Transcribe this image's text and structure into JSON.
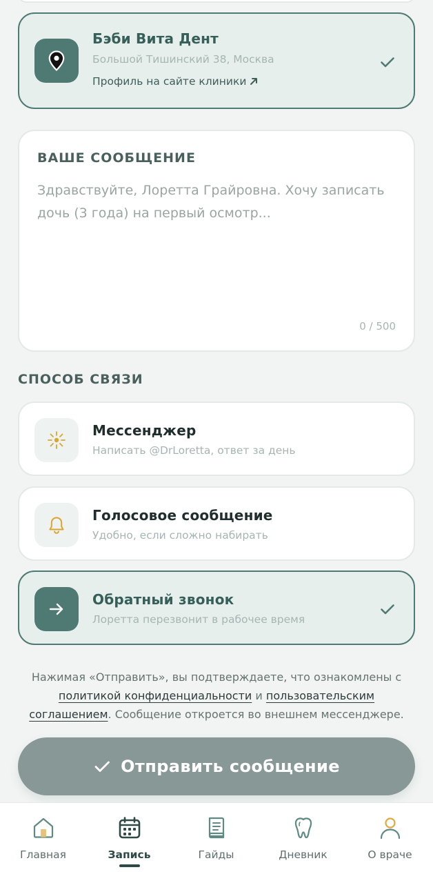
{
  "clinic": {
    "name": "Бэби Вита Дент",
    "address": "Большой Тишинский 38, Москва",
    "profile_link": "Профиль на сайте клиники",
    "selected": true
  },
  "message": {
    "label": "ВАШЕ СООБЩЕНИЕ",
    "placeholder": "Здравствуйте, Лоретта Грайровна. Хочу записать дочь (3 года) на первый осмотр...",
    "counter": "0 / 500"
  },
  "contact": {
    "label": "СПОСОБ СВЯЗИ",
    "options": [
      {
        "title": "Мессенджер",
        "subtitle": "Написать @DrLoretta, ответ за день",
        "icon": "sun-icon",
        "selected": false
      },
      {
        "title": "Голосовое сообщение",
        "subtitle": "Удобно, если сложно набирать",
        "icon": "bell-icon",
        "selected": false
      },
      {
        "title": "Обратный звонок",
        "subtitle": "Лоретта перезвонит в рабочее время",
        "icon": "arrow-right-icon",
        "selected": true
      }
    ]
  },
  "consent": {
    "prefix": "Нажимая «Отправить», вы подтверждаете, что ознакомлены с ",
    "privacy_link": "политикой конфиденциальности",
    "and": " и ",
    "terms_link": "пользовательским соглашением",
    "suffix": ". Сообщение откроется во внешнем мессенджере."
  },
  "submit_label": "Отправить сообщение",
  "nav": {
    "items": [
      {
        "label": "Главная",
        "icon": "home-icon",
        "active": false
      },
      {
        "label": "Запись",
        "icon": "calendar-icon",
        "active": true
      },
      {
        "label": "Гайды",
        "icon": "book-icon",
        "active": false
      },
      {
        "label": "Дневник",
        "icon": "tooth-icon",
        "active": false
      },
      {
        "label": "О враче",
        "icon": "person-icon",
        "active": false
      }
    ]
  },
  "colors": {
    "accent": "#4f7a73",
    "selected_bg": "#e6efec",
    "submit_bg": "#889897",
    "icon_gold": "#d9a631",
    "background": "#f1f4f3"
  }
}
